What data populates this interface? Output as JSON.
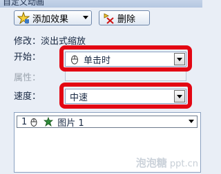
{
  "window": {
    "title": "自定义动画"
  },
  "toolbar": {
    "add_effect_label": "添加效果",
    "delete_label": "删除"
  },
  "modify": {
    "text": "修改：淡出式缩放"
  },
  "start": {
    "label": "开始：",
    "value": "单击时"
  },
  "property": {
    "label": "属性：",
    "value": ""
  },
  "speed": {
    "label": "速度：",
    "value": "中速"
  },
  "effects_list": [
    {
      "number": "1",
      "name": "图片 1"
    }
  ],
  "watermark": {
    "text_big": "泡泡糖",
    "text_small": "ppt.cn"
  },
  "colors": {
    "highlight": "#e30613",
    "panel": "#e9eef6"
  }
}
